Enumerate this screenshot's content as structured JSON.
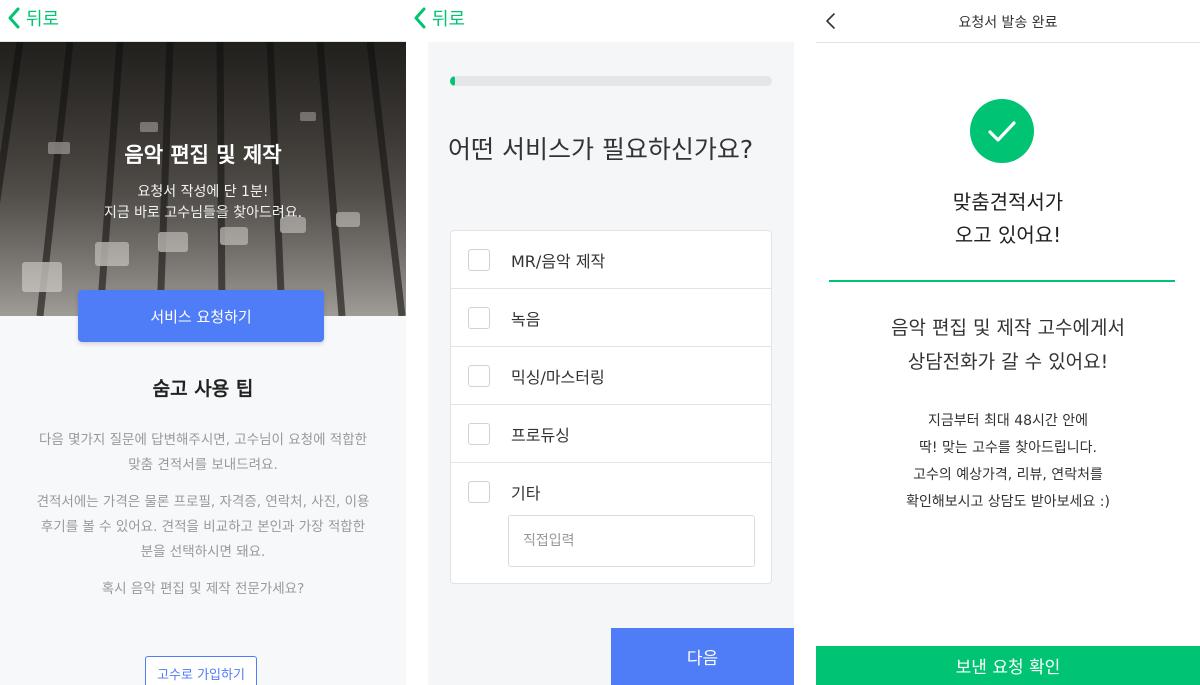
{
  "colors": {
    "brand_green": "#00c473",
    "button_blue": "#4f7cf7",
    "muted_text": "#999999"
  },
  "intro_screen": {
    "back_label": "뒤로",
    "hero_title": "음악 편집 및 제작",
    "hero_subtitle_line1": "요청서 작성에 단 1분!",
    "hero_subtitle_line2": "지금 바로 고수님들을 찾아드려요.",
    "request_button": "서비스 요청하기",
    "tips_title": "숨고 사용 팁",
    "tip1_line1": "다음 몇가지 질문에 답변해주시면, 고수님이 요청에 적합한",
    "tip1_line2": "맞춤 견적서를 보내드려요.",
    "tip2_line1": "견적서에는 가격은 물론 프로필, 자격증, 연락처, 사진, 이용",
    "tip2_line2": "후기를 볼 수 있어요. 견적을 비교하고 본인과 가장 적합한",
    "tip2_line3": "분을 선택하시면 돼요.",
    "tip3": "혹시 음악 편집 및 제작 전문가세요?",
    "join_button": "고수로 가입하기"
  },
  "question_screen": {
    "back_label": "뒤로",
    "progress_fraction": 0.01,
    "question": "어떤 서비스가 필요하신가요?",
    "options": [
      {
        "label": "MR/음악 제작",
        "checked": false
      },
      {
        "label": "녹음",
        "checked": false
      },
      {
        "label": "믹싱/마스터링",
        "checked": false
      },
      {
        "label": "프로듀싱",
        "checked": false
      },
      {
        "label": "기타",
        "checked": false
      }
    ],
    "direct_input_placeholder": "직접입력",
    "next_button": "다음"
  },
  "done_screen": {
    "title": "요청서 발송 완료",
    "heading_line1": "맞춤견적서가",
    "heading_line2": "오고 있어요!",
    "message_line1": "음악 편집 및 제작 고수에게서",
    "message_line2": "상담전화가 갈 수 있어요!",
    "info_line1": "지금부터 최대 48시간 안에",
    "info_line2": "딱! 맞는 고수를 찾아드립니다.",
    "info_line3": "고수의 예상가격, 리뷰, 연락처를",
    "info_line4": "확인해보시고 상담도 받아보세요 :)",
    "confirm_button": "보낸 요청 확인"
  }
}
